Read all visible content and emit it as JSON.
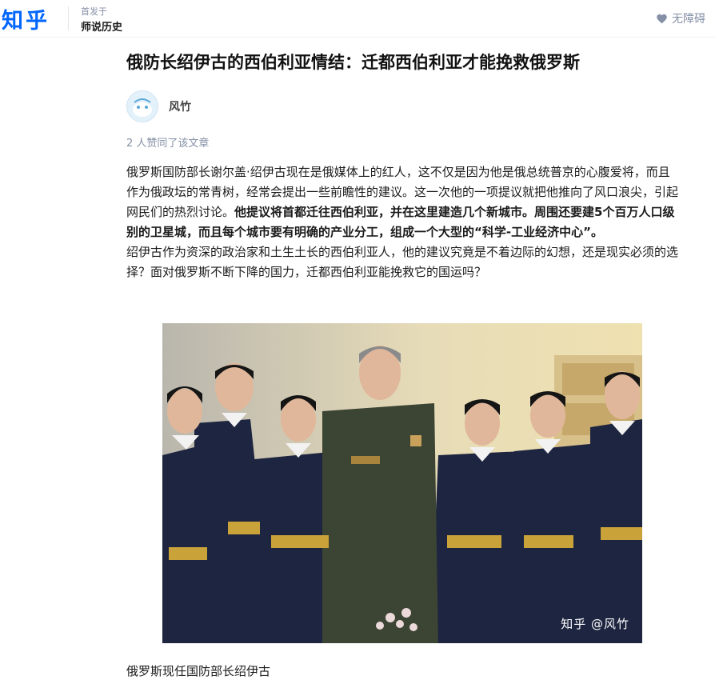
{
  "header": {
    "logo": "知乎",
    "published_in_label": "首发于",
    "column_name": "师说历史",
    "accessibility_label": "无障碍"
  },
  "article": {
    "title": "俄防长绍伊古的西伯利亚情结：迁都西伯利亚才能挽救俄罗斯",
    "author": "风竹",
    "likes_text": "2 人赞同了该文章",
    "paragraph1_normal": "俄罗斯国防部长谢尔盖·绍伊古现在是俄媒体上的红人，这不仅是因为他是俄总统普京的心腹爱将，而且作为俄政坛的常青树，经常会提出一些前瞻性的建议。这一次他的一项提议就把他推向了风口浪尖，引起网民们的热烈讨论。",
    "paragraph1_bold": "他提议将首都迁往西伯利亚，并在这里建造几个新城市。周围还要建5个百万人口级别的卫星城，而且每个城市要有明确的产业分工，组成一个大型的“科学-工业经济中心”。",
    "paragraph2": "绍伊古作为资深的政治家和土生土长的西伯利亚人，他的建议究竟是不着边际的幻想，还是现实必须的选择？面对俄罗斯不断下降的国力，迁都西伯利亚能挽救它的国运吗？",
    "image_watermark": "知乎 @风竹",
    "image_caption": "俄罗斯现任国防部长绍伊古"
  },
  "colors": {
    "brand": "#0066ff",
    "muted": "#8590a6",
    "text": "#1a1a1a"
  },
  "icons": {
    "accessibility": "heart-icon"
  }
}
